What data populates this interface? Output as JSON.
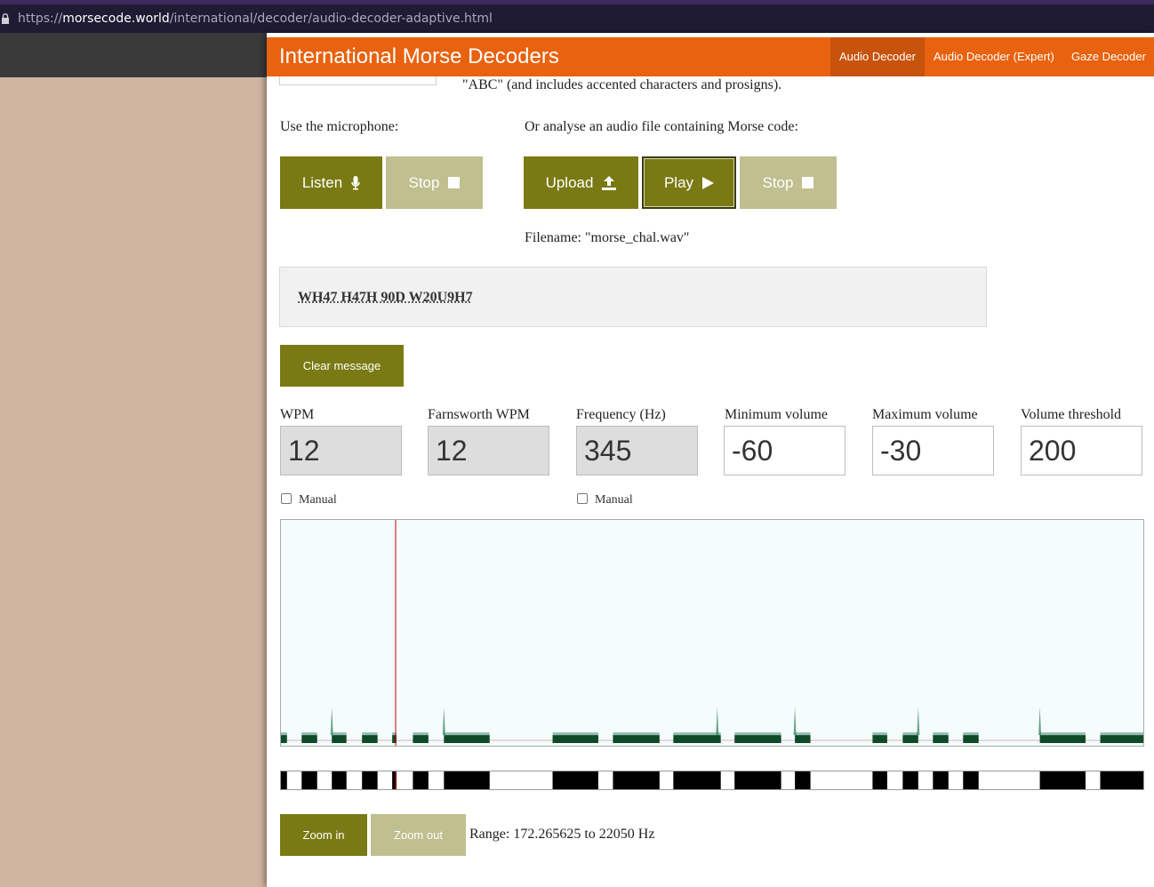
{
  "browser": {
    "url_scheme": "https://",
    "url_host": "morsecode.world",
    "url_path": "/international/decoder/audio-decoder-adaptive.html"
  },
  "nav": {
    "site_title": "International Morse Decoders",
    "links": [
      "Audio Decoder",
      "Audio Decoder (Expert)",
      "Gaze Decoder"
    ],
    "active": "Audio Decoder"
  },
  "intro": {
    "abc_note": "\"ABC\" (and includes accented characters and prosigns)."
  },
  "mic": {
    "label": "Use the microphone:",
    "listen": "Listen",
    "stop": "Stop"
  },
  "file": {
    "label": "Or analyse an audio file containing Morse code:",
    "upload": "Upload",
    "play": "Play",
    "stop": "Stop",
    "filename": "Filename: \"morse_chal.wav\""
  },
  "message": {
    "text": "WH47 H47H 90D W20U9H7",
    "clear": "Clear message"
  },
  "settings": [
    {
      "label": "WPM",
      "value": "12",
      "readonly": true
    },
    {
      "label": "Farnsworth WPM",
      "value": "12",
      "readonly": true
    },
    {
      "label": "Frequency (Hz)",
      "value": "345",
      "readonly": true
    },
    {
      "label": "Minimum volume",
      "value": "-60",
      "readonly": false
    },
    {
      "label": "Maximum volume",
      "value": "-30",
      "readonly": false
    },
    {
      "label": "Volume threshold",
      "value": "200",
      "readonly": false
    }
  ],
  "manual_label": "Manual",
  "zoom": {
    "zoom_in": "Zoom in",
    "zoom_out": "Zoom out",
    "range": "Range: 172.265625 to 22050 Hz"
  },
  "colors": {
    "nav": "#e8620f",
    "nav_active": "#c8530c",
    "button_dark": "#7a7a14",
    "button_light": "#bfbf8f",
    "signal": "#0e4a28",
    "cursor": "#cc0000"
  },
  "playback_fraction": 0.133,
  "signal_segments": [
    {
      "on": 0.0,
      "off": 0.007
    },
    {
      "on": 0.024,
      "off": 0.042
    },
    {
      "on": 0.059,
      "off": 0.076
    },
    {
      "on": 0.094,
      "off": 0.112
    },
    {
      "on": 0.129,
      "off": 0.134
    },
    {
      "on": 0.153,
      "off": 0.171
    },
    {
      "on": 0.189,
      "off": 0.242
    },
    {
      "on": 0.315,
      "off": 0.368
    },
    {
      "on": 0.385,
      "off": 0.439
    },
    {
      "on": 0.455,
      "off": 0.51
    },
    {
      "on": 0.526,
      "off": 0.58
    },
    {
      "on": 0.596,
      "off": 0.614
    },
    {
      "on": 0.686,
      "off": 0.703
    },
    {
      "on": 0.721,
      "off": 0.739
    },
    {
      "on": 0.756,
      "off": 0.774
    },
    {
      "on": 0.791,
      "off": 0.809
    },
    {
      "on": 0.88,
      "off": 0.933
    },
    {
      "on": 0.95,
      "off": 1.0
    }
  ],
  "signal_spikes": [
    0.059,
    0.189,
    0.506,
    0.596,
    0.739,
    0.88
  ]
}
